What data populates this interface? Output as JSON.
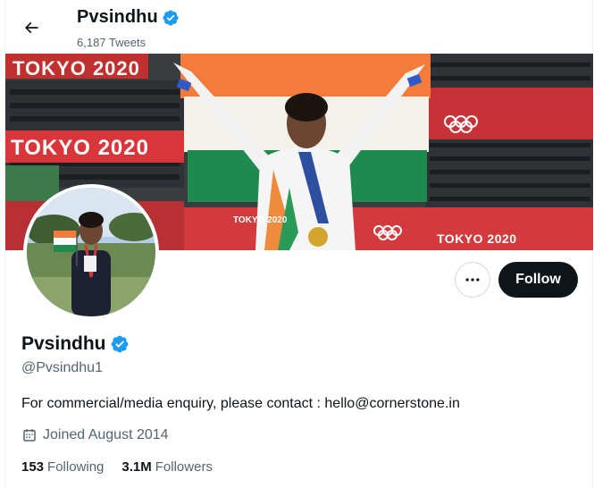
{
  "header": {
    "name": "Pvsindhu",
    "tweet_count": "6,187 Tweets"
  },
  "banner": {
    "text_top": "TOKYO 2020",
    "text_mid": "TOKYO 2020",
    "text_small": "TOKYO 2020",
    "text_right": "TOKYO 2020"
  },
  "profile": {
    "name": "Pvsindhu",
    "handle": "@Pvsindhu1",
    "bio": "For commercial/media enquiry, please contact : hello@cornerstone.in",
    "joined": "Joined August 2014",
    "following_count": "153",
    "following_label": "Following",
    "followers_count": "3.1M",
    "followers_label": "Followers"
  },
  "actions": {
    "follow_label": "Follow"
  },
  "icons": {
    "back": "arrow-left-icon",
    "verified": "verified-badge-icon",
    "more": "more-dots-icon",
    "calendar": "calendar-icon"
  },
  "colors": {
    "verified_blue": "#1d9bf0",
    "follow_bg": "#0f1419",
    "secondary_text": "#536471"
  }
}
